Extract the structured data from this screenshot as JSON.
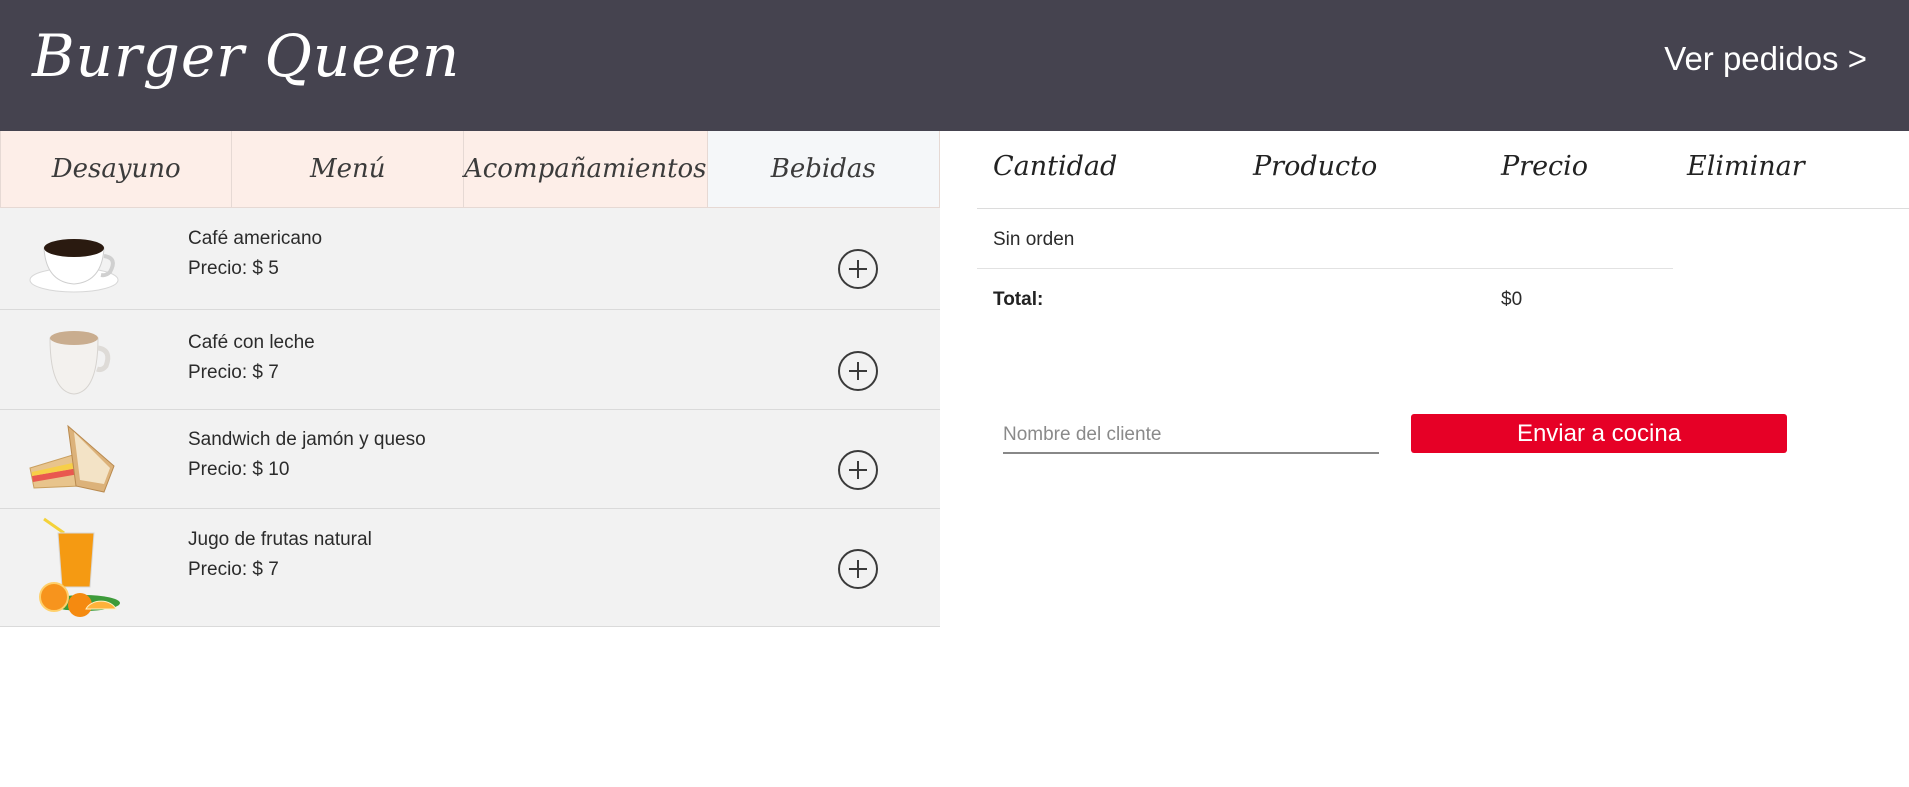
{
  "header": {
    "brand": "Burger Queen",
    "orders_link": "Ver pedidos >"
  },
  "tabs": [
    {
      "label": "Desayuno"
    },
    {
      "label": "Menú"
    },
    {
      "label": "Acompañamientos"
    },
    {
      "label": "Bebidas",
      "active": true
    }
  ],
  "items": [
    {
      "name": "Café americano",
      "price_label": "Precio: $ 5",
      "icon": "black-coffee-cup-icon"
    },
    {
      "name": "Café con leche",
      "price_label": "Precio: $ 7",
      "icon": "latte-cup-icon"
    },
    {
      "name": "Sandwich de jamón y queso",
      "price_label": "Precio: $ 10",
      "icon": "sandwich-icon"
    },
    {
      "name": "Jugo de frutas natural",
      "price_label": "Precio: $ 7",
      "icon": "orange-juice-icon"
    }
  ],
  "order": {
    "columns": [
      "Cantidad",
      "Producto",
      "Precio",
      "Eliminar"
    ],
    "empty_text": "Sin orden",
    "total_label": "Total:",
    "total_value": "$0"
  },
  "form": {
    "client_placeholder": "Nombre del cliente",
    "client_value": "",
    "send_label": "Enviar a cocina"
  },
  "colors": {
    "header_bg": "#45434f",
    "tab_bg": "#fdeee8",
    "tab_active_bg": "#f5f7f9",
    "item_bg": "#f2f2f2",
    "accent": "#e60026"
  }
}
